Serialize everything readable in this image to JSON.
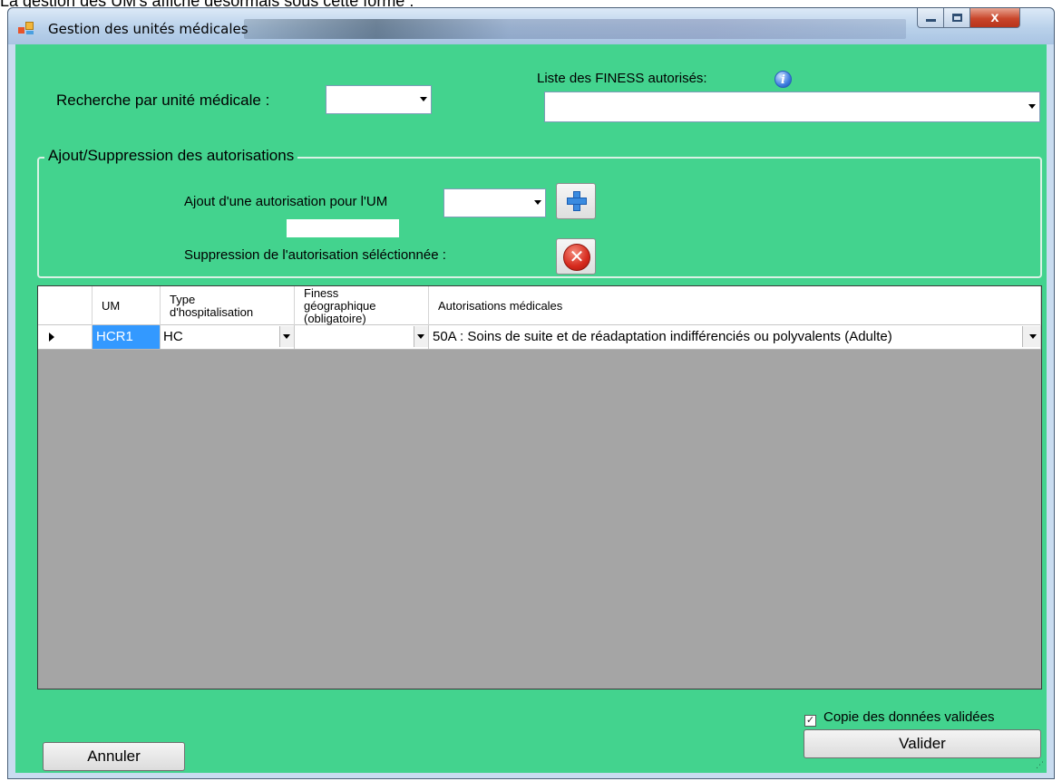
{
  "caption": "La gestion des UM's affiche désormais sous cette forme :",
  "window": {
    "title": "Gestion des unités médicales",
    "close_glyph": "x"
  },
  "search": {
    "label": "Recherche par unité médicale :",
    "value": ""
  },
  "finess": {
    "label": "Liste des FINESS autorisés:",
    "info_icon": "i",
    "value": ""
  },
  "auth_group": {
    "title": "Ajout/Suppression des autorisations",
    "add_label": "Ajout d'une autorisation pour l'UM",
    "add_value": "",
    "delete_label": "Suppression de l'autorisation séléctionnée :"
  },
  "grid": {
    "columns": [
      "UM",
      "Type\nd'hospitalisation",
      "Finess\ngéographique\n(obligatoire)",
      "Autorisations médicales"
    ],
    "rows": [
      {
        "um": "HCR1",
        "type": "HC",
        "finess": "",
        "autorisation": "50A : Soins de suite et de réadaptation indifférenciés ou polyvalents (Adulte)"
      }
    ]
  },
  "footer": {
    "checkbox_label": "Copie des données validées",
    "checkbox_checked": true,
    "checkbox_mark": "✓",
    "cancel_label": "Annuler",
    "validate_label": "Valider"
  },
  "colors": {
    "client_bg": "#43d38e",
    "grid_bg": "#a5a5a5",
    "selected_cell": "#3399ff"
  }
}
